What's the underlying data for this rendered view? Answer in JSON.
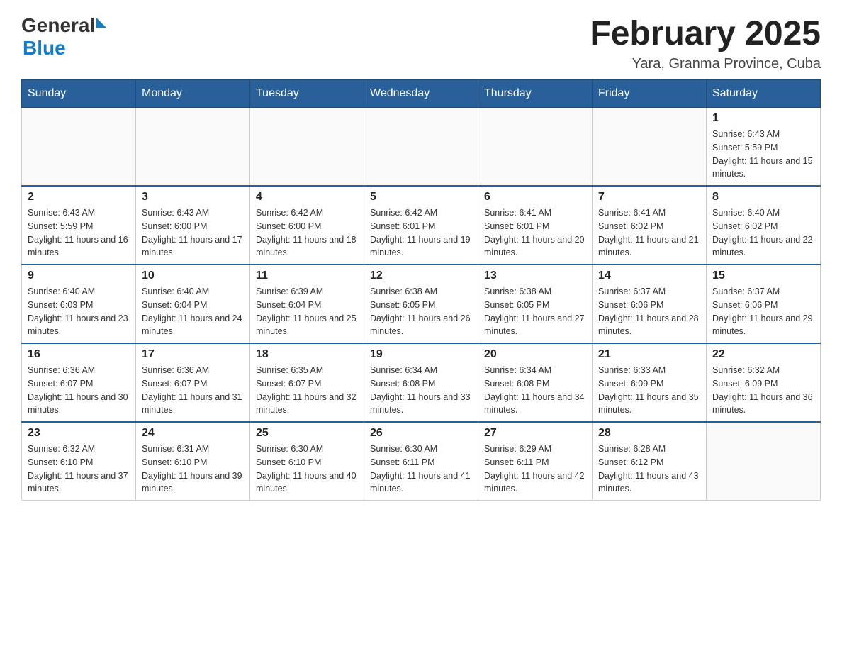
{
  "header": {
    "logo_general": "General",
    "logo_blue": "Blue",
    "title": "February 2025",
    "subtitle": "Yara, Granma Province, Cuba"
  },
  "weekdays": [
    "Sunday",
    "Monday",
    "Tuesday",
    "Wednesday",
    "Thursday",
    "Friday",
    "Saturday"
  ],
  "weeks": [
    [
      {
        "day": "",
        "sunrise": "",
        "sunset": "",
        "daylight": ""
      },
      {
        "day": "",
        "sunrise": "",
        "sunset": "",
        "daylight": ""
      },
      {
        "day": "",
        "sunrise": "",
        "sunset": "",
        "daylight": ""
      },
      {
        "day": "",
        "sunrise": "",
        "sunset": "",
        "daylight": ""
      },
      {
        "day": "",
        "sunrise": "",
        "sunset": "",
        "daylight": ""
      },
      {
        "day": "",
        "sunrise": "",
        "sunset": "",
        "daylight": ""
      },
      {
        "day": "1",
        "sunrise": "Sunrise: 6:43 AM",
        "sunset": "Sunset: 5:59 PM",
        "daylight": "Daylight: 11 hours and 15 minutes."
      }
    ],
    [
      {
        "day": "2",
        "sunrise": "Sunrise: 6:43 AM",
        "sunset": "Sunset: 5:59 PM",
        "daylight": "Daylight: 11 hours and 16 minutes."
      },
      {
        "day": "3",
        "sunrise": "Sunrise: 6:43 AM",
        "sunset": "Sunset: 6:00 PM",
        "daylight": "Daylight: 11 hours and 17 minutes."
      },
      {
        "day": "4",
        "sunrise": "Sunrise: 6:42 AM",
        "sunset": "Sunset: 6:00 PM",
        "daylight": "Daylight: 11 hours and 18 minutes."
      },
      {
        "day": "5",
        "sunrise": "Sunrise: 6:42 AM",
        "sunset": "Sunset: 6:01 PM",
        "daylight": "Daylight: 11 hours and 19 minutes."
      },
      {
        "day": "6",
        "sunrise": "Sunrise: 6:41 AM",
        "sunset": "Sunset: 6:01 PM",
        "daylight": "Daylight: 11 hours and 20 minutes."
      },
      {
        "day": "7",
        "sunrise": "Sunrise: 6:41 AM",
        "sunset": "Sunset: 6:02 PM",
        "daylight": "Daylight: 11 hours and 21 minutes."
      },
      {
        "day": "8",
        "sunrise": "Sunrise: 6:40 AM",
        "sunset": "Sunset: 6:02 PM",
        "daylight": "Daylight: 11 hours and 22 minutes."
      }
    ],
    [
      {
        "day": "9",
        "sunrise": "Sunrise: 6:40 AM",
        "sunset": "Sunset: 6:03 PM",
        "daylight": "Daylight: 11 hours and 23 minutes."
      },
      {
        "day": "10",
        "sunrise": "Sunrise: 6:40 AM",
        "sunset": "Sunset: 6:04 PM",
        "daylight": "Daylight: 11 hours and 24 minutes."
      },
      {
        "day": "11",
        "sunrise": "Sunrise: 6:39 AM",
        "sunset": "Sunset: 6:04 PM",
        "daylight": "Daylight: 11 hours and 25 minutes."
      },
      {
        "day": "12",
        "sunrise": "Sunrise: 6:38 AM",
        "sunset": "Sunset: 6:05 PM",
        "daylight": "Daylight: 11 hours and 26 minutes."
      },
      {
        "day": "13",
        "sunrise": "Sunrise: 6:38 AM",
        "sunset": "Sunset: 6:05 PM",
        "daylight": "Daylight: 11 hours and 27 minutes."
      },
      {
        "day": "14",
        "sunrise": "Sunrise: 6:37 AM",
        "sunset": "Sunset: 6:06 PM",
        "daylight": "Daylight: 11 hours and 28 minutes."
      },
      {
        "day": "15",
        "sunrise": "Sunrise: 6:37 AM",
        "sunset": "Sunset: 6:06 PM",
        "daylight": "Daylight: 11 hours and 29 minutes."
      }
    ],
    [
      {
        "day": "16",
        "sunrise": "Sunrise: 6:36 AM",
        "sunset": "Sunset: 6:07 PM",
        "daylight": "Daylight: 11 hours and 30 minutes."
      },
      {
        "day": "17",
        "sunrise": "Sunrise: 6:36 AM",
        "sunset": "Sunset: 6:07 PM",
        "daylight": "Daylight: 11 hours and 31 minutes."
      },
      {
        "day": "18",
        "sunrise": "Sunrise: 6:35 AM",
        "sunset": "Sunset: 6:07 PM",
        "daylight": "Daylight: 11 hours and 32 minutes."
      },
      {
        "day": "19",
        "sunrise": "Sunrise: 6:34 AM",
        "sunset": "Sunset: 6:08 PM",
        "daylight": "Daylight: 11 hours and 33 minutes."
      },
      {
        "day": "20",
        "sunrise": "Sunrise: 6:34 AM",
        "sunset": "Sunset: 6:08 PM",
        "daylight": "Daylight: 11 hours and 34 minutes."
      },
      {
        "day": "21",
        "sunrise": "Sunrise: 6:33 AM",
        "sunset": "Sunset: 6:09 PM",
        "daylight": "Daylight: 11 hours and 35 minutes."
      },
      {
        "day": "22",
        "sunrise": "Sunrise: 6:32 AM",
        "sunset": "Sunset: 6:09 PM",
        "daylight": "Daylight: 11 hours and 36 minutes."
      }
    ],
    [
      {
        "day": "23",
        "sunrise": "Sunrise: 6:32 AM",
        "sunset": "Sunset: 6:10 PM",
        "daylight": "Daylight: 11 hours and 37 minutes."
      },
      {
        "day": "24",
        "sunrise": "Sunrise: 6:31 AM",
        "sunset": "Sunset: 6:10 PM",
        "daylight": "Daylight: 11 hours and 39 minutes."
      },
      {
        "day": "25",
        "sunrise": "Sunrise: 6:30 AM",
        "sunset": "Sunset: 6:10 PM",
        "daylight": "Daylight: 11 hours and 40 minutes."
      },
      {
        "day": "26",
        "sunrise": "Sunrise: 6:30 AM",
        "sunset": "Sunset: 6:11 PM",
        "daylight": "Daylight: 11 hours and 41 minutes."
      },
      {
        "day": "27",
        "sunrise": "Sunrise: 6:29 AM",
        "sunset": "Sunset: 6:11 PM",
        "daylight": "Daylight: 11 hours and 42 minutes."
      },
      {
        "day": "28",
        "sunrise": "Sunrise: 6:28 AM",
        "sunset": "Sunset: 6:12 PM",
        "daylight": "Daylight: 11 hours and 43 minutes."
      },
      {
        "day": "",
        "sunrise": "",
        "sunset": "",
        "daylight": ""
      }
    ]
  ]
}
